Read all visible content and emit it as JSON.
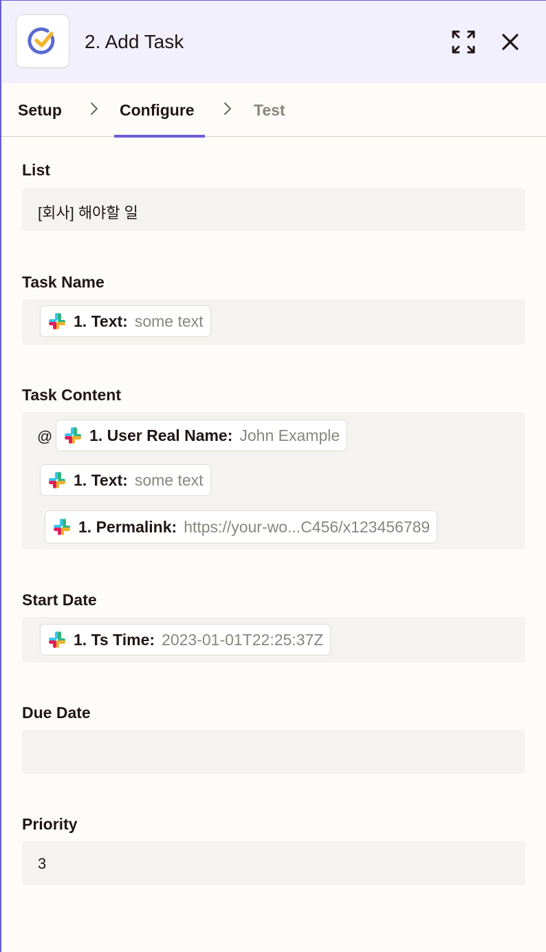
{
  "header": {
    "title": "2. Add Task",
    "app_icon": "ticktick-check-icon",
    "expand_icon": "expand-icon",
    "close_icon": "close-icon"
  },
  "tabs": [
    {
      "label": "Setup",
      "state": "done"
    },
    {
      "label": "Configure",
      "state": "active"
    },
    {
      "label": "Test",
      "state": "disabled"
    }
  ],
  "fields": {
    "list": {
      "label": "List",
      "value": "[회사] 해야할 일"
    },
    "task_name": {
      "label": "Task Name",
      "pills": [
        {
          "label": "1. Text:",
          "value": "some text"
        }
      ]
    },
    "task_content": {
      "label": "Task Content",
      "prefix": "@",
      "pills": [
        {
          "label": "1. User Real Name:",
          "value": "John Example"
        },
        {
          "label": "1. Text:",
          "value": "some text"
        },
        {
          "label": "1. Permalink:",
          "value": "https://your-wo...C456/x123456789"
        }
      ]
    },
    "start_date": {
      "label": "Start Date",
      "pills": [
        {
          "label": "1. Ts Time:",
          "value": "2023-01-01T22:25:37Z"
        }
      ]
    },
    "due_date": {
      "label": "Due Date",
      "value": ""
    },
    "priority": {
      "label": "Priority",
      "value": "3"
    }
  },
  "colors": {
    "accent": "#6a5cd6",
    "header_bg": "#f1f0fc",
    "field_bg": "#f4f3ef",
    "muted_text": "#8a857d"
  }
}
